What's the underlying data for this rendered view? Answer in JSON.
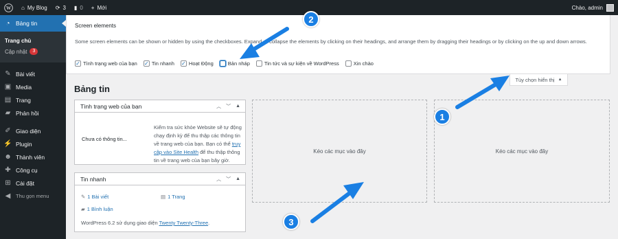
{
  "adminbar": {
    "site_name": "My Blog",
    "updates_count": "3",
    "comments_count": "0",
    "new_label": "Mới",
    "greeting": "Chào, admin"
  },
  "sidebar": {
    "dashboard": "Bảng tin",
    "submenu": {
      "home": "Trang chủ",
      "updates": "Cập nhật",
      "updates_badge": "3"
    },
    "items": [
      "Bài viết",
      "Media",
      "Trang",
      "Phản hồi",
      "Giao diện",
      "Plugin",
      "Thành viên",
      "Công cụ",
      "Cài đặt"
    ],
    "collapse": "Thu gọn menu"
  },
  "screen_options": {
    "heading": "Screen elements",
    "description": "Some screen elements can be shown or hidden by using the checkboxes. Expand or collapse the elements by clicking on their headings, and arrange them by dragging their headings or by clicking on the up and down arrows.",
    "checkboxes": [
      {
        "label": "Tình trạng web của bạn",
        "checked": true
      },
      {
        "label": "Tin nhanh",
        "checked": true
      },
      {
        "label": "Hoạt Động",
        "checked": true
      },
      {
        "label": "Bản nháp",
        "checked": false
      },
      {
        "label": "Tin tức và sự kiện về WordPress",
        "checked": false
      },
      {
        "label": "Xin chào",
        "checked": false
      }
    ],
    "toggle_label": "Tùy chọn hiển thị",
    "toggle_arrow": "▲"
  },
  "page_title": "Bảng tin",
  "site_health": {
    "title": "Tình trạng web của bạn",
    "no_info": "Chưa có thông tin...",
    "text_before": "Kiểm tra sức khỏe Website sẽ tự động chạy định kỳ để thu thập các thông tin về trang web của bạn. Bạn có thể ",
    "link": "truy cập vào Site Health",
    "text_after": " để thu thập thông tin về trang web của bạn bây giờ."
  },
  "glance": {
    "title": "Tin nhanh",
    "posts": "1 Bài viết",
    "pages": "1 Trang",
    "comments": "1 Bình luận",
    "theme_text": "WordPress 6.2 sử dụng giao diện ",
    "theme_link": "Twenty Twenty-Three",
    "theme_end": "."
  },
  "dropzones": [
    "Kéo các mục vào đây",
    "Kéo các mục vào đây"
  ],
  "annotations": [
    "1",
    "2",
    "3"
  ],
  "colors": {
    "accent": "#2271b1",
    "adminbar": "#1d2327",
    "annotation": "#1a7fe3"
  }
}
